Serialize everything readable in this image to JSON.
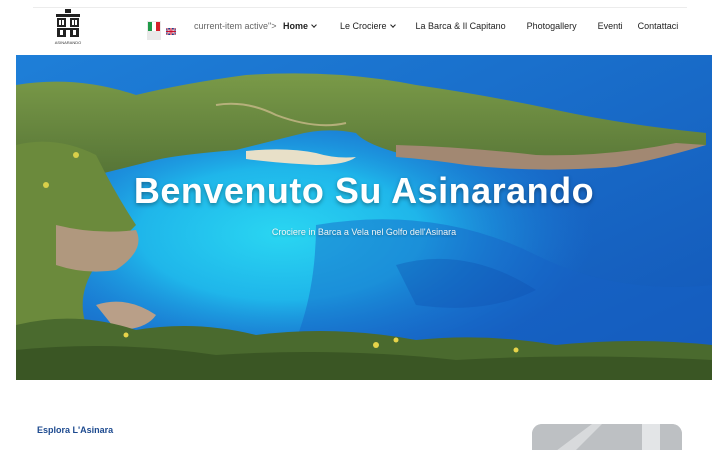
{
  "header": {
    "logo_caption": "ASINARANDO",
    "languages": [
      {
        "code": "it",
        "name": "Italiano",
        "active": true
      },
      {
        "code": "en",
        "name": "English",
        "active": false
      }
    ],
    "stray_text": "current-item active\">",
    "nav": [
      {
        "label": "Home",
        "has_dropdown": true
      },
      {
        "label": "Le Crociere",
        "has_dropdown": true
      },
      {
        "label": "La Barca & Il Capitano",
        "has_dropdown": false
      },
      {
        "label": "Photogallery",
        "has_dropdown": false
      },
      {
        "label": "Eventi",
        "has_dropdown": false
      },
      {
        "label": "Contattaci",
        "has_dropdown": false
      }
    ]
  },
  "hero": {
    "title": "Benvenuto Su Asinarando",
    "subtitle": "Crociere in Barca a Vela nel Golfo dell'Asinara"
  },
  "section": {
    "label": "Esplora L'Asinara"
  },
  "colors": {
    "accent": "#1d4a8f",
    "sea_deep": "#1a6fd0",
    "sea_turquoise": "#22c3ea",
    "text": "#222222"
  }
}
